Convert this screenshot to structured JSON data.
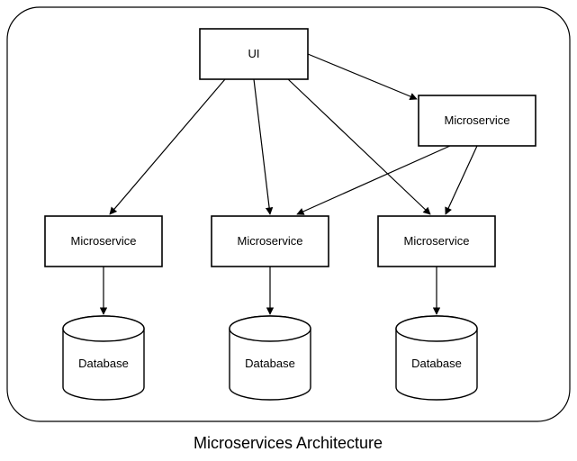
{
  "title": "Microservices Architecture",
  "nodes": {
    "ui": {
      "label": "UI"
    },
    "ms_right": {
      "label": "Microservice"
    },
    "ms1": {
      "label": "Microservice"
    },
    "ms2": {
      "label": "Microservice"
    },
    "ms3": {
      "label": "Microservice"
    },
    "db1": {
      "label": "Database"
    },
    "db2": {
      "label": "Database"
    },
    "db3": {
      "label": "Database"
    }
  },
  "edges": [
    {
      "from": "ui",
      "to": "ms_right"
    },
    {
      "from": "ui",
      "to": "ms1"
    },
    {
      "from": "ui",
      "to": "ms2"
    },
    {
      "from": "ui",
      "to": "ms3"
    },
    {
      "from": "ms_right",
      "to": "ms2"
    },
    {
      "from": "ms_right",
      "to": "ms3"
    },
    {
      "from": "ms1",
      "to": "db1"
    },
    {
      "from": "ms2",
      "to": "db2"
    },
    {
      "from": "ms3",
      "to": "db3"
    }
  ]
}
